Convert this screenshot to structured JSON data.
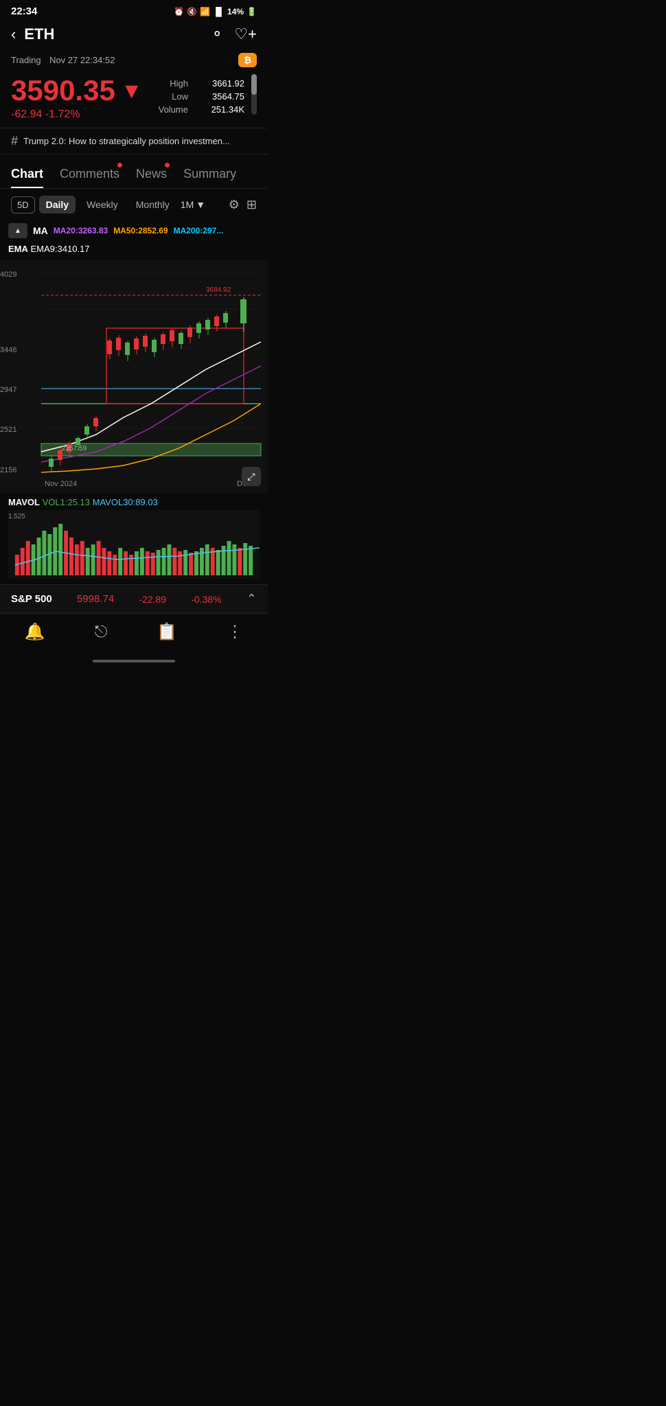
{
  "statusBar": {
    "time": "22:34",
    "battery": "14%",
    "signal": "●"
  },
  "header": {
    "back": "‹",
    "title": "ETH",
    "searchIcon": "○",
    "watchlistIcon": "♡+"
  },
  "trading": {
    "label": "Trading",
    "datetime": "Nov 27 22:34:52",
    "btcBadge": "₿"
  },
  "price": {
    "main": "3590.35",
    "arrow": "▼",
    "change": "-62.94 -1.72%",
    "high_label": "High",
    "high_value": "3661.92",
    "low_label": "Low",
    "low_value": "3564.75",
    "volume_label": "Volume",
    "volume_value": "251.34K"
  },
  "newsTicker": {
    "hash": "#",
    "text": "Trump 2.0: How to strategically position investmen..."
  },
  "tabs": [
    {
      "id": "chart",
      "label": "Chart",
      "active": true,
      "dot": false
    },
    {
      "id": "comments",
      "label": "Comments",
      "active": false,
      "dot": true
    },
    {
      "id": "news",
      "label": "News",
      "active": false,
      "dot": true
    },
    {
      "id": "summary",
      "label": "Summary",
      "active": false,
      "dot": false
    }
  ],
  "chartControls": {
    "5d": "5D",
    "daily": "Daily",
    "weekly": "Weekly",
    "monthly": "Monthly",
    "interval": "1M",
    "dropArrow": "▼"
  },
  "ma": {
    "label": "MA",
    "ma20_label": "MA20:",
    "ma20_value": "3263.83",
    "ma50_label": "MA50:",
    "ma50_value": "2852.69",
    "ma200_label": "MA200:",
    "ma200_value": "297..."
  },
  "ema": {
    "label": "EMA",
    "ema9_label": "EMA9:",
    "ema9_value": "3410.17"
  },
  "chartPrices": {
    "top": "4029",
    "mid1": "3684.92",
    "mid2": "3446",
    "mid3": "2947",
    "mid4": "2521",
    "mid5": "2357.59",
    "bottom": "2156",
    "dateLeft": "Nov 2024",
    "dateRight": "Dec"
  },
  "volume": {
    "label": "MAVOL",
    "vol1_label": "VOL1:",
    "vol1_value": "25.13",
    "vol30_label": "MAVOL30:",
    "vol30_value": "89.03",
    "scale": "1.525"
  },
  "bottomTicker": {
    "name": "S&P 500",
    "price": "5998.74",
    "change1": "-22.89",
    "change2": "-0.38%"
  },
  "bottomNav": {
    "alert": "🔔+",
    "share": "↗",
    "calendar": "📅",
    "more": "⋮"
  }
}
